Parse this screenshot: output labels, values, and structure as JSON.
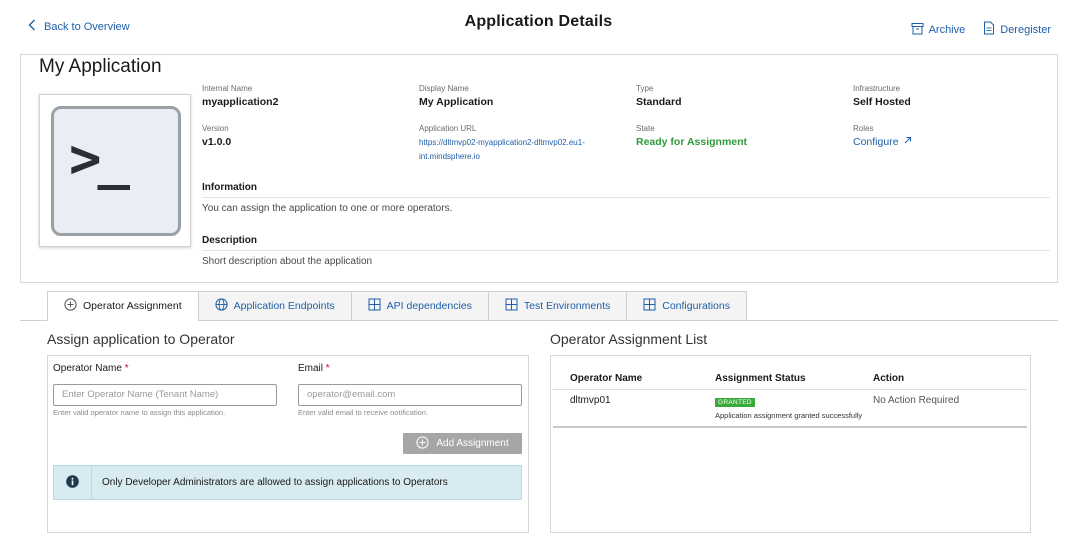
{
  "header": {
    "back_label": "Back to Overview",
    "title": "Application Details",
    "archive_label": "Archive",
    "deregister_label": "Deregister"
  },
  "app": {
    "name": "My Application",
    "icon_glyph": ">_",
    "fields": {
      "internal_name_label": "Internal Name",
      "internal_name": "myapplication2",
      "display_name_label": "Display Name",
      "display_name": "My Application",
      "type_label": "Type",
      "type": "Standard",
      "infrastructure_label": "Infrastructure",
      "infrastructure": "Self Hosted",
      "version_label": "Version",
      "version": "v1.0.0",
      "url_label": "Application URL",
      "url_line1": "https://dltmvp02-myapplication2-dltmvp02.eu1-",
      "url_line2": "int.mindsphere.io",
      "state_label": "State",
      "state": "Ready for Assignment",
      "roles_label": "Roles",
      "roles_link": "Configure"
    },
    "information_head": "Information",
    "information_text": "You can assign the application to one or more operators.",
    "description_head": "Description",
    "description_text": "Short description about the application"
  },
  "tabs": [
    {
      "label": "Operator Assignment",
      "icon": "plus-circle-icon",
      "active": true
    },
    {
      "label": "Application Endpoints",
      "icon": "globe-icon",
      "active": false
    },
    {
      "label": "API dependencies",
      "icon": "grid-icon",
      "active": false
    },
    {
      "label": "Test Environments",
      "icon": "grid-icon",
      "active": false
    },
    {
      "label": "Configurations",
      "icon": "grid-icon",
      "active": false
    }
  ],
  "assign": {
    "heading": "Assign application to Operator",
    "operator_label": "Operator Name",
    "operator_placeholder": "Enter Operator Name (Tenant Name)",
    "operator_hint": "Enter valid operator name to assign this application.",
    "email_label": "Email",
    "email_placeholder": "operator@email.com",
    "email_hint": "Enter valid email to receive notification.",
    "required_mark": "*",
    "add_button": "Add Assignment",
    "info_text": "Only Developer Administrators are allowed to assign applications to Operators"
  },
  "list": {
    "heading": "Operator Assignment List",
    "col_operator": "Operator Name",
    "col_status": "Assignment Status",
    "col_action": "Action",
    "rows": [
      {
        "operator": "dltmvp01",
        "status_badge": "GRANTED",
        "status_note": "Application assignment granted successfully",
        "action": "No Action Required"
      }
    ]
  },
  "colors": {
    "link": "#1e5fa8",
    "success": "#2e9b3a",
    "info_bg": "#d7ebf0",
    "button_disabled": "#a6a6a6"
  }
}
